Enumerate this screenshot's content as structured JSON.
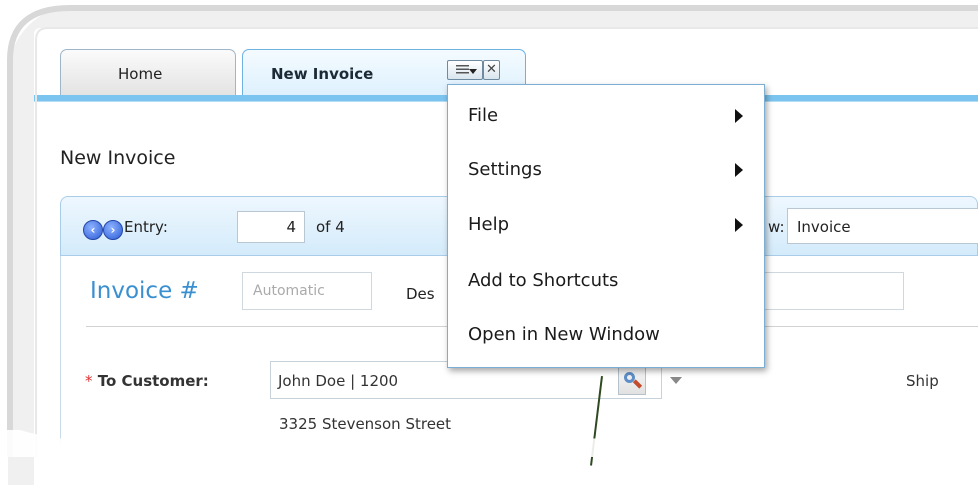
{
  "tabs": [
    {
      "label": "Home"
    },
    {
      "label": "New Invoice"
    }
  ],
  "tab_buttons": {
    "menu_icon": "menu-dropdown-icon",
    "close_glyph": "✕"
  },
  "page_title": "New Invoice",
  "toolbar": {
    "prev_icon": "arrow-left-icon",
    "next_icon": "arrow-right-icon",
    "entry_label": "Entry:",
    "entry_value": "4",
    "of_label": "of 4",
    "view_label": "w:",
    "view_value": "Invoice"
  },
  "form": {
    "invoice_label": "Invoice #",
    "invoice_placeholder": "Automatic",
    "desc_label": "Des",
    "customer_required": "*",
    "customer_label": "To Customer:",
    "customer_value": "John Doe | 1200",
    "ship_label": "Ship",
    "address_line": "3325 Stevenson Street"
  },
  "menu": {
    "items": [
      {
        "label": "File",
        "has_submenu": true
      },
      {
        "label": "Settings",
        "has_submenu": true
      },
      {
        "label": "Help",
        "has_submenu": true
      },
      {
        "label": "Add to Shortcuts",
        "has_submenu": false
      },
      {
        "label": "Open in New Window",
        "has_submenu": false
      }
    ]
  },
  "colors": {
    "accent": "#3a8fd0",
    "tab_line": "#7cc4f0",
    "required": "#e03030"
  }
}
